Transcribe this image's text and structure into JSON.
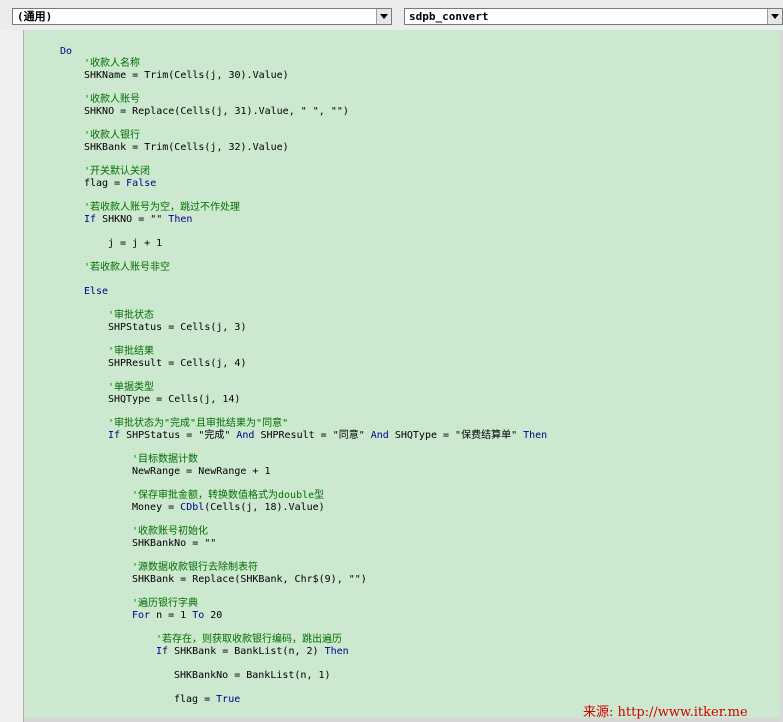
{
  "header": {
    "object_combo": "(通用)",
    "procedure_combo": "sdpb_convert"
  },
  "code": {
    "lines": [
      {
        "indent": 0,
        "parts": [
          {
            "t": "Do",
            "c": "kw"
          }
        ]
      },
      {
        "indent": 1,
        "parts": [
          {
            "t": "'收款人名称",
            "c": "cm"
          }
        ]
      },
      {
        "indent": 1,
        "parts": [
          {
            "t": "SHKName = Trim(Cells(j, 30).Value)",
            "c": ""
          }
        ]
      },
      {
        "indent": 1,
        "parts": [
          {
            "t": "'收款人账号",
            "c": "cm"
          }
        ]
      },
      {
        "indent": 1,
        "parts": [
          {
            "t": "SHKNO = Replace(Cells(j, 31).Value, \" \", \"\")",
            "c": ""
          }
        ]
      },
      {
        "indent": 1,
        "parts": [
          {
            "t": "'收款人银行",
            "c": "cm"
          }
        ]
      },
      {
        "indent": 1,
        "parts": [
          {
            "t": "SHKBank = Trim(Cells(j, 32).Value)",
            "c": ""
          }
        ]
      },
      {
        "indent": 1,
        "parts": [
          {
            "t": "'开关默认关闭",
            "c": "cm"
          }
        ]
      },
      {
        "indent": 1,
        "parts": [
          {
            "t": "flag = ",
            "c": ""
          },
          {
            "t": "False",
            "c": "kw"
          }
        ]
      },
      {
        "indent": 1,
        "parts": [
          {
            "t": "'若收款人账号为空，跳过不作处理",
            "c": "cm"
          }
        ]
      },
      {
        "indent": 1,
        "parts": [
          {
            "t": "If",
            "c": "kw"
          },
          {
            "t": " SHKNO = \"\" ",
            "c": ""
          },
          {
            "t": "Then",
            "c": "kw"
          }
        ]
      },
      {
        "indent": 2,
        "parts": [
          {
            "t": "j = j + 1",
            "c": ""
          }
        ]
      },
      {
        "indent": 1,
        "parts": [
          {
            "t": "'若收款人账号非空",
            "c": "cm"
          }
        ]
      },
      {
        "indent": 1,
        "parts": [
          {
            "t": "Else",
            "c": "kw"
          }
        ]
      },
      {
        "indent": 2,
        "parts": [
          {
            "t": "'审批状态",
            "c": "cm"
          }
        ]
      },
      {
        "indent": 2,
        "parts": [
          {
            "t": "SHPStatus = Cells(j, 3)",
            "c": ""
          }
        ]
      },
      {
        "indent": 2,
        "parts": [
          {
            "t": "'审批结果",
            "c": "cm"
          }
        ]
      },
      {
        "indent": 2,
        "parts": [
          {
            "t": "SHPResult = Cells(j, 4)",
            "c": ""
          }
        ]
      },
      {
        "indent": 2,
        "parts": [
          {
            "t": "'单据类型",
            "c": "cm"
          }
        ]
      },
      {
        "indent": 2,
        "parts": [
          {
            "t": "SHQType = Cells(j, 14)",
            "c": ""
          }
        ]
      },
      {
        "indent": 2,
        "parts": [
          {
            "t": "'审批状态为\"完成\"且审批结果为\"同意\"",
            "c": "cm"
          }
        ]
      },
      {
        "indent": 2,
        "parts": [
          {
            "t": "If",
            "c": "kw"
          },
          {
            "t": " SHPStatus = \"完成\" ",
            "c": ""
          },
          {
            "t": "And",
            "c": "kw"
          },
          {
            "t": " SHPResult = \"同意\" ",
            "c": ""
          },
          {
            "t": "And",
            "c": "kw"
          },
          {
            "t": " SHQType = \"保费结算单\" ",
            "c": ""
          },
          {
            "t": "Then",
            "c": "kw"
          }
        ]
      },
      {
        "indent": 3,
        "parts": [
          {
            "t": "'目标数据计数",
            "c": "cm"
          }
        ]
      },
      {
        "indent": 3,
        "parts": [
          {
            "t": "NewRange = NewRange + 1",
            "c": ""
          }
        ]
      },
      {
        "indent": 3,
        "parts": [
          {
            "t": "'保存审批金额，转换数值格式为double型",
            "c": "cm"
          }
        ]
      },
      {
        "indent": 3,
        "parts": [
          {
            "t": "Money = ",
            "c": ""
          },
          {
            "t": "CDbl",
            "c": "kw"
          },
          {
            "t": "(Cells(j, 18).Value)",
            "c": ""
          }
        ]
      },
      {
        "indent": 3,
        "parts": [
          {
            "t": "'收款账号初始化",
            "c": "cm"
          }
        ]
      },
      {
        "indent": 3,
        "parts": [
          {
            "t": "SHKBankNo = \"\"",
            "c": ""
          }
        ]
      },
      {
        "indent": 3,
        "parts": [
          {
            "t": "'源数据收款银行去除制表符",
            "c": "cm"
          }
        ]
      },
      {
        "indent": 3,
        "parts": [
          {
            "t": "SHKBank = Replace(SHKBank, Chr$(9), \"\")",
            "c": ""
          }
        ]
      },
      {
        "indent": 3,
        "parts": [
          {
            "t": "'遍历银行字典",
            "c": "cm"
          }
        ]
      },
      {
        "indent": 3,
        "parts": [
          {
            "t": "For",
            "c": "kw"
          },
          {
            "t": " n = 1 ",
            "c": ""
          },
          {
            "t": "To",
            "c": "kw"
          },
          {
            "t": " 20",
            "c": ""
          }
        ]
      },
      {
        "indent": 4,
        "parts": [
          {
            "t": "'若存在，则获取收款银行编码，跳出遍历",
            "c": "cm"
          }
        ]
      },
      {
        "indent": 4,
        "parts": [
          {
            "t": "If",
            "c": "kw"
          },
          {
            "t": " SHKBank = BankList(n, 2) ",
            "c": ""
          },
          {
            "t": "Then",
            "c": "kw"
          }
        ]
      },
      {
        "indent": 5,
        "parts": [
          {
            "t": "SHKBankNo = BankList(n, 1)",
            "c": ""
          }
        ]
      },
      {
        "indent": 5,
        "parts": [
          {
            "t": "flag = ",
            "c": ""
          },
          {
            "t": "True",
            "c": "kw"
          }
        ]
      }
    ]
  },
  "watermark": "来源: http://www.itker.me"
}
